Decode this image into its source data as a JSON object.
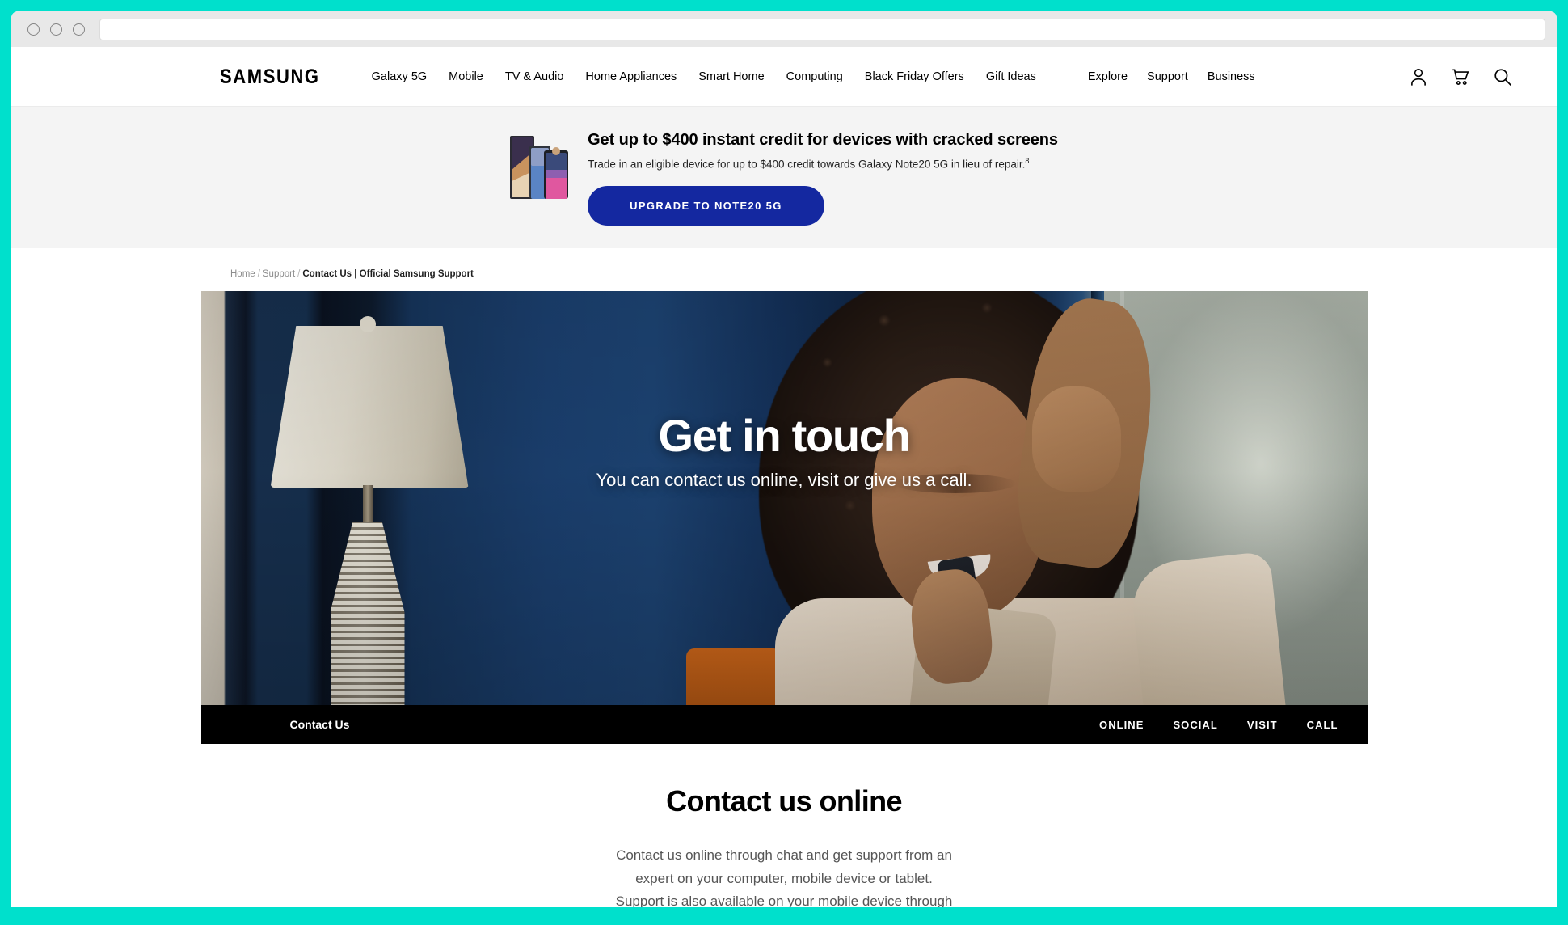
{
  "browser": {
    "url_value": "",
    "url_placeholder": ""
  },
  "gnb": {
    "logo": "SAMSUNG",
    "primary_links": [
      {
        "label": "Galaxy 5G"
      },
      {
        "label": "Mobile"
      },
      {
        "label": "TV & Audio"
      },
      {
        "label": "Home Appliances"
      },
      {
        "label": "Smart Home"
      },
      {
        "label": "Computing"
      },
      {
        "label": "Black Friday Offers"
      },
      {
        "label": "Gift Ideas"
      }
    ],
    "secondary_links": [
      {
        "label": "Explore"
      },
      {
        "label": "Support"
      },
      {
        "label": "Business"
      }
    ],
    "icons": [
      {
        "name": "account-icon"
      },
      {
        "name": "cart-icon"
      },
      {
        "name": "search-icon"
      }
    ]
  },
  "promo": {
    "title": "Get up to $400 instant credit for devices with cracked screens",
    "subtitle": "Trade in an eligible device for up to $400 credit towards Galaxy Note20 5G in lieu of repair.",
    "subtitle_footnote": "8",
    "button_label": "UPGRADE TO NOTE20 5G",
    "button_color": "#1428a0",
    "background_color": "#f4f4f4"
  },
  "breadcrumb": {
    "items": [
      {
        "label": "Home",
        "current": false
      },
      {
        "label": "Support",
        "current": false
      },
      {
        "label": "Contact Us | Official Samsung Support",
        "current": true
      }
    ],
    "separator": "/"
  },
  "hero": {
    "title": "Get in touch",
    "subtitle": "You can contact us online, visit or give us a call.",
    "tabs_label": "Contact Us",
    "tabs": [
      {
        "label": "ONLINE"
      },
      {
        "label": "SOCIAL"
      },
      {
        "label": "VISIT"
      },
      {
        "label": "CALL"
      }
    ],
    "tabbar_color": "#000000"
  },
  "section": {
    "title": "Contact us online",
    "body_lines": [
      "Contact us online through chat and get support from an",
      "expert on your computer, mobile device or tablet.",
      "Support is also available on your mobile device through"
    ]
  },
  "theme": {
    "frame_accent": "#00e0cc",
    "chrome_bg": "#e8e8e8"
  }
}
